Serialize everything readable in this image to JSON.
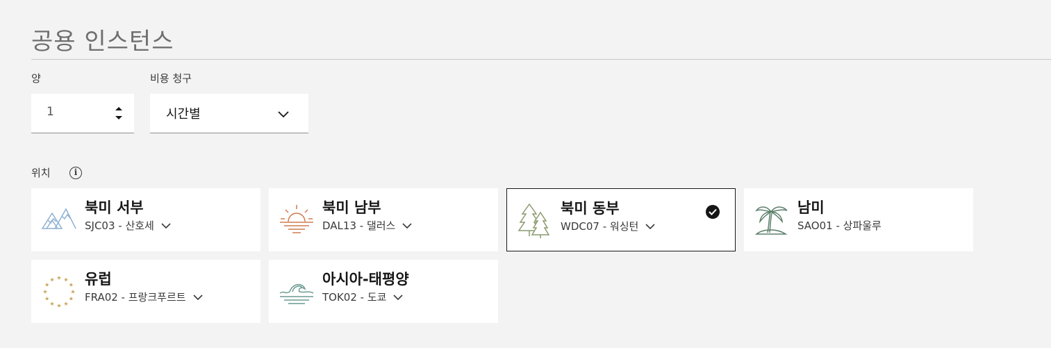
{
  "page": {
    "title": "공용 인스턴스"
  },
  "quantity": {
    "label": "양",
    "value": "1"
  },
  "billing": {
    "label": "비용 청구",
    "value": "시간별"
  },
  "location": {
    "label": "위치",
    "regions": [
      {
        "name": "북미 서부",
        "datacenter": "SJC03 - 산호세",
        "icon": "mountains-icon",
        "has_dropdown": true,
        "selected": false
      },
      {
        "name": "북미 남부",
        "datacenter": "DAL13 - 댈러스",
        "icon": "sun-icon",
        "has_dropdown": true,
        "selected": false
      },
      {
        "name": "북미 동부",
        "datacenter": "WDC07 - 워싱턴",
        "icon": "pine-trees-icon",
        "has_dropdown": true,
        "selected": true
      },
      {
        "name": "남미",
        "datacenter": "SAO01 - 상파울루",
        "icon": "palm-tree-icon",
        "has_dropdown": false,
        "selected": false
      },
      {
        "name": "유럽",
        "datacenter": "FRA02 - 프랑크푸르트",
        "icon": "eu-stars-icon",
        "has_dropdown": true,
        "selected": false
      },
      {
        "name": "아시아-태평양",
        "datacenter": "TOK02 - 도쿄",
        "icon": "wave-icon",
        "has_dropdown": true,
        "selected": false
      }
    ]
  },
  "colors": {
    "mountains": "#8fb0d4",
    "sun": "#d17a4e",
    "pine": "#8a9a6f",
    "palm": "#5b7f6a",
    "eu": "#c9a75a",
    "wave": "#6a9a92"
  }
}
